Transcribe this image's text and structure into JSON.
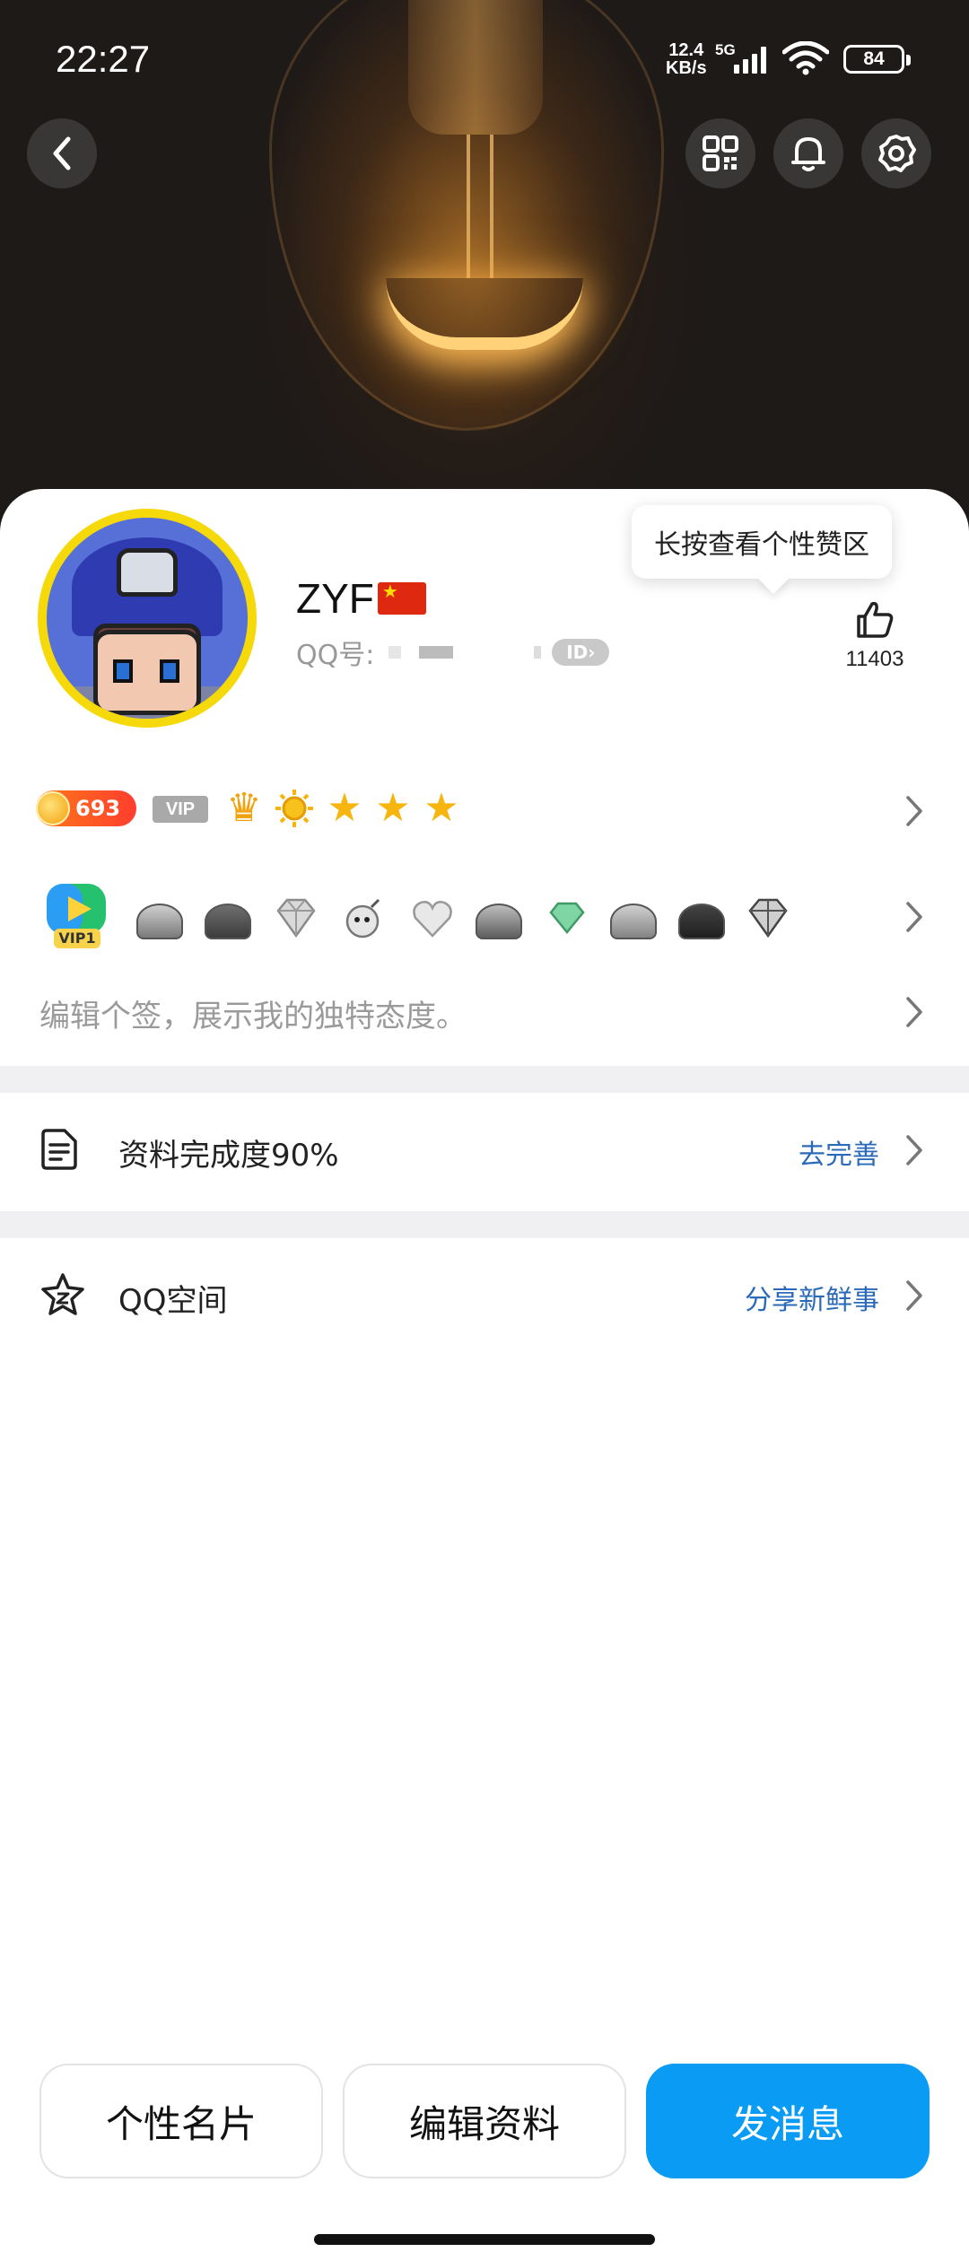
{
  "status_bar": {
    "time": "22:27",
    "network_speed_value": "12.4",
    "network_speed_unit": "KB/s",
    "network_type": "5G",
    "battery": "84"
  },
  "header": {
    "icons": [
      "back-icon",
      "qr-code-icon",
      "bell-icon",
      "gear-icon"
    ]
  },
  "profile": {
    "name": "ZYF",
    "qq_label": "QQ号:",
    "id_badge": "ID",
    "tooltip": "长按查看个性赞区",
    "likes": "11403"
  },
  "level": {
    "coin_value": "693",
    "vip_tag": "VIP",
    "vip_video_label": "VIP1"
  },
  "signature_placeholder": "编辑个签，展示我的独特态度。",
  "completion": {
    "label": "资料完成度90%",
    "action": "去完善"
  },
  "qzone": {
    "label": "QQ空间",
    "action": "分享新鲜事"
  },
  "buttons": {
    "card": "个性名片",
    "edit": "编辑资料",
    "message": "发消息"
  },
  "colors": {
    "accent": "#0a9bf5",
    "link": "#2a6ab8",
    "coin_badge": "#ff5a24"
  }
}
